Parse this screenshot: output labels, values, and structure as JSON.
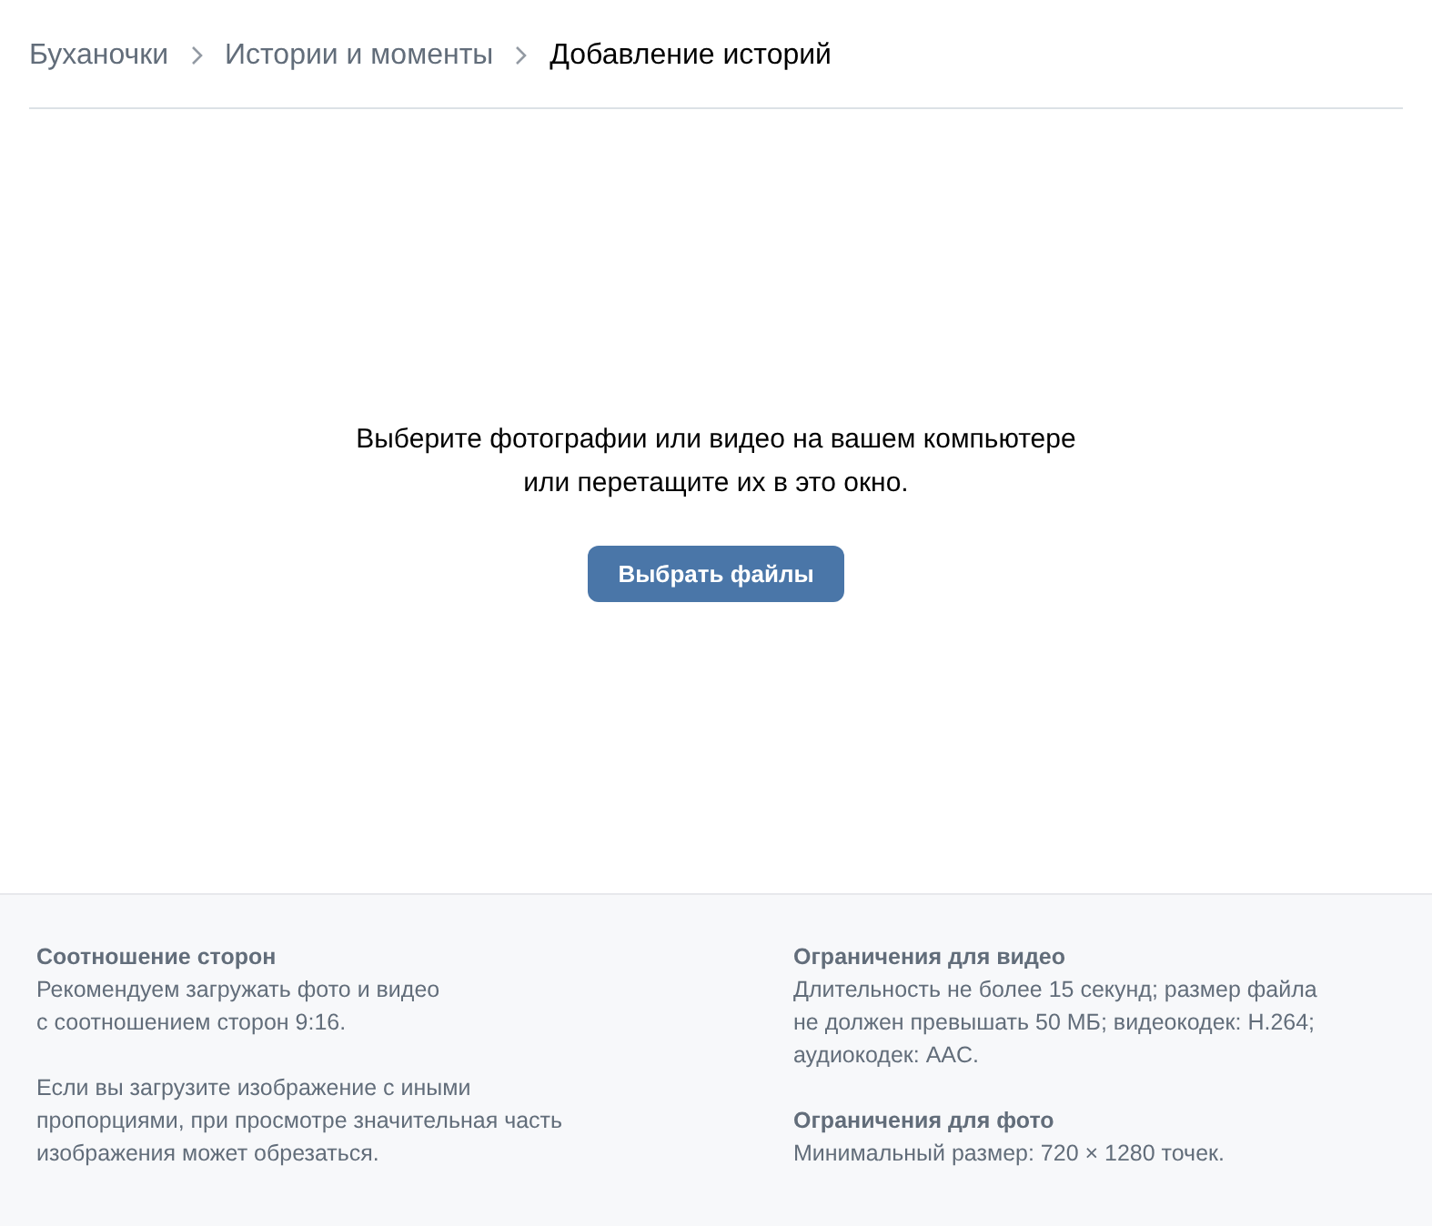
{
  "breadcrumbs": [
    {
      "label": "Буханочки",
      "current": false
    },
    {
      "label": "Истории и моменты",
      "current": false
    },
    {
      "label": "Добавление историй",
      "current": true
    }
  ],
  "upload": {
    "prompt_lines": [
      "Выберите фотографии или видео на вашем компьютере",
      "или перетащите их в это окно."
    ],
    "button": "Выбрать файлы"
  },
  "info_columns": [
    {
      "sections": [
        {
          "title": "Соотношение сторон",
          "lines": [
            "Рекомендуем загружать фото и видео",
            "с соотношением сторон 9:16."
          ]
        },
        {
          "lines": [
            "Если вы загрузите изображение с иными",
            "пропорциями, при просмотре значительная часть",
            "изображения может обрезаться."
          ]
        }
      ]
    },
    {
      "sections": [
        {
          "title": "Ограничения для видео",
          "lines": [
            "Длительность не более 15 секунд; размер файла",
            "не должен превышать 50 МБ; видеокодек: H.264;",
            "аудиокодек: AAC."
          ]
        },
        {
          "title": "Ограничения для фото",
          "lines": [
            "Минимальный размер: 720 × 1280 точек."
          ]
        }
      ]
    }
  ]
}
